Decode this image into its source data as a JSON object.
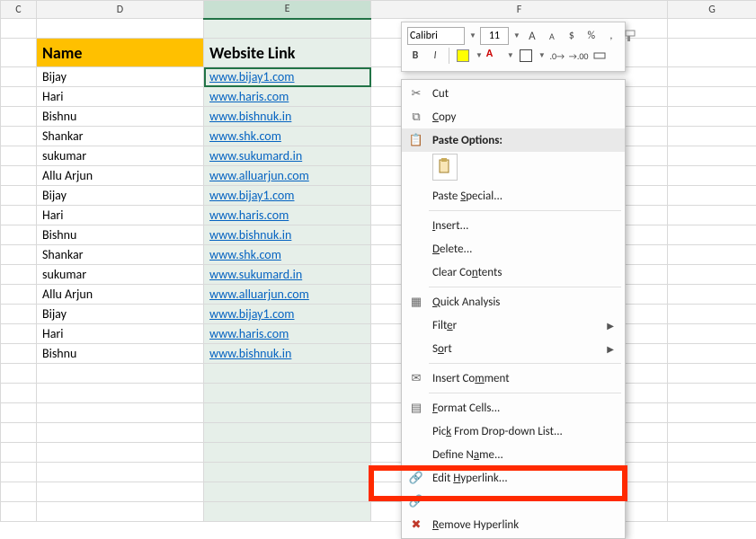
{
  "columns": [
    "C",
    "D",
    "E",
    "F",
    "G"
  ],
  "headers": {
    "d": "Name",
    "e": "Website Link"
  },
  "rows": [
    {
      "name": "Bijay",
      "link": "www.bijay1.com"
    },
    {
      "name": "Hari",
      "link": "www.haris.com"
    },
    {
      "name": "Bishnu",
      "link": "www.bishnuk.in"
    },
    {
      "name": "Shankar",
      "link": "www.shk.com"
    },
    {
      "name": "sukumar",
      "link": "www.sukumard.in"
    },
    {
      "name": "Allu Arjun",
      "link": "www.alluarjun.com"
    },
    {
      "name": "Bijay",
      "link": "www.bijay1.com"
    },
    {
      "name": "Hari",
      "link": "www.haris.com"
    },
    {
      "name": "Bishnu",
      "link": "www.bishnuk.in"
    },
    {
      "name": "Shankar",
      "link": "www.shk.com"
    },
    {
      "name": "sukumar",
      "link": "www.sukumard.in"
    },
    {
      "name": "Allu Arjun",
      "link": "www.alluarjun.com"
    },
    {
      "name": "Bijay",
      "link": "www.bijay1.com"
    },
    {
      "name": "Hari",
      "link": "www.haris.com"
    },
    {
      "name": "Bishnu",
      "link": "www.bishnuk.in"
    }
  ],
  "blank_rows_after": 8,
  "partial_email_visible": "",
  "mini_toolbar": {
    "font_name": "Calibri",
    "font_size": "11",
    "increase_font": "A",
    "decrease_font": "A",
    "currency": "$",
    "percent": "%",
    "comma": ",",
    "bold": "B",
    "italic": "I",
    "font_color_letter": "A"
  },
  "context_menu": {
    "cut_icon": "✂",
    "copy_icon": "⧉",
    "paste_icon": "📋",
    "cut": "Cut",
    "copy": "Copy",
    "paste_options": "Paste Options:",
    "paste_special": "Paste Special...",
    "insert": "Insert...",
    "delete": "Delete...",
    "clear_contents": "Clear Contents",
    "quick_analysis_icon": "▦",
    "quick_analysis": "Quick Analysis",
    "filter": "Filter",
    "sort": "Sort",
    "insert_comment_icon": "✉",
    "insert_comment": "Insert Comment",
    "format_cells_icon": "▤",
    "format_cells": "Format Cells...",
    "pick_list": "Pick From Drop-down List...",
    "define_name": "Define Name...",
    "edit_hyperlink_icon": "🔗",
    "edit_hyperlink": "Edit Hyperlink...",
    "open_hyperlink": "",
    "remove_hyperlink_icon": "✖",
    "remove_hyperlink": "Remove Hyperlink"
  }
}
